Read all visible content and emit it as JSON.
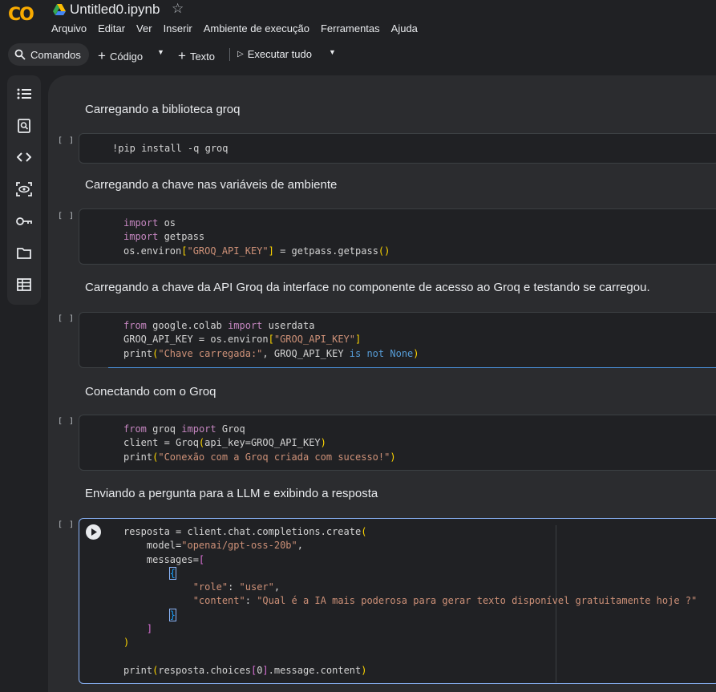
{
  "header": {
    "logo": "CO",
    "title": "Untitled0.ipynb",
    "menu": [
      "Arquivo",
      "Editar",
      "Ver",
      "Inserir",
      "Ambiente de execução",
      "Ferramentas",
      "Ajuda"
    ]
  },
  "toolbar": {
    "commands": "Comandos",
    "code": "Código",
    "text": "Texto",
    "run_all": "Executar tudo"
  },
  "sidebar": {
    "icons": [
      "table-of-contents-icon",
      "find-icon",
      "code-snippets-icon",
      "variables-icon",
      "secrets-key-icon",
      "files-icon",
      "data-table-icon"
    ]
  },
  "cells": [
    {
      "type": "markdown",
      "text": "Carregando a biblioteca groq"
    },
    {
      "type": "code",
      "bracket": "[ ]",
      "code": "!pip install -q groq"
    },
    {
      "type": "markdown",
      "text": "Carregando a chave nas variáveis de ambiente"
    },
    {
      "type": "code",
      "bracket": "[ ]",
      "code": "import os\nimport getpass\nos.environ[\"GROQ_API_KEY\"] = getpass.getpass()"
    },
    {
      "type": "markdown",
      "text": "Carregando a chave da API Groq da interface no componente de acesso ao Groq e testando se carregou."
    },
    {
      "type": "code",
      "bracket": "[ ]",
      "code": "from google.colab import userdata\nGROQ_API_KEY = os.environ[\"GROQ_API_KEY\"]\nprint(\"Chave carregada:\", GROQ_API_KEY is not None)"
    },
    {
      "type": "markdown",
      "text": "Conectando com o Groq"
    },
    {
      "type": "code",
      "bracket": "[ ]",
      "code": "from groq import Groq\nclient = Groq(api_key=GROQ_API_KEY)\nprint(\"Conexão com a Groq criada com sucesso!\")"
    },
    {
      "type": "markdown",
      "text": "Enviando a pergunta para a LLM e exibindo a resposta"
    },
    {
      "type": "code",
      "bracket": "[ ]",
      "code": "resposta = client.chat.completions.create(\n    model=\"openai/gpt-oss-20b\",\n    messages=[\n        {\n            \"role\": \"user\",\n            \"content\": \"Qual é a IA mais poderosa para gerar texto disponível gratuitamente hoje ?\"\n        }\n    ]\n)\n\nprint(resposta.choices[0].message.content)"
    }
  ],
  "colors": {
    "accent": "#f9ab00",
    "keyword": "#c586c0",
    "string": "#ce9178",
    "builtin": "#569cd6",
    "focus": "#8ab4f8"
  }
}
